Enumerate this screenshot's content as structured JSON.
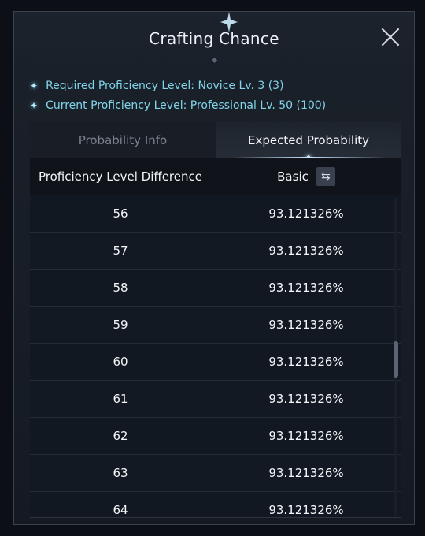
{
  "window": {
    "title": "Crafting Chance",
    "close_label": "close"
  },
  "requirements": {
    "required": "Required Proficiency Level: Novice Lv. 3 (3)",
    "current": "Current Proficiency Level: Professional Lv. 50 (100)"
  },
  "tabs": [
    {
      "label": "Probability Info",
      "active": false
    },
    {
      "label": "Expected Probability",
      "active": true
    }
  ],
  "table": {
    "headers": {
      "difference": "Proficiency Level Difference",
      "basic": "Basic"
    },
    "rows": [
      {
        "diff": "56",
        "prob": "93.121326%"
      },
      {
        "diff": "57",
        "prob": "93.121326%"
      },
      {
        "diff": "58",
        "prob": "93.121326%"
      },
      {
        "diff": "59",
        "prob": "93.121326%"
      },
      {
        "diff": "60",
        "prob": "93.121326%"
      },
      {
        "diff": "61",
        "prob": "93.121326%"
      },
      {
        "diff": "62",
        "prob": "93.121326%"
      },
      {
        "diff": "63",
        "prob": "93.121326%"
      },
      {
        "diff": "64",
        "prob": "93.121326%"
      }
    ]
  },
  "icons": {
    "bullet": "star-bullet-icon",
    "swap": "swap-icon",
    "close": "close-icon"
  },
  "colors": {
    "accent_text": "#82d4ea",
    "background": "#151a22"
  }
}
